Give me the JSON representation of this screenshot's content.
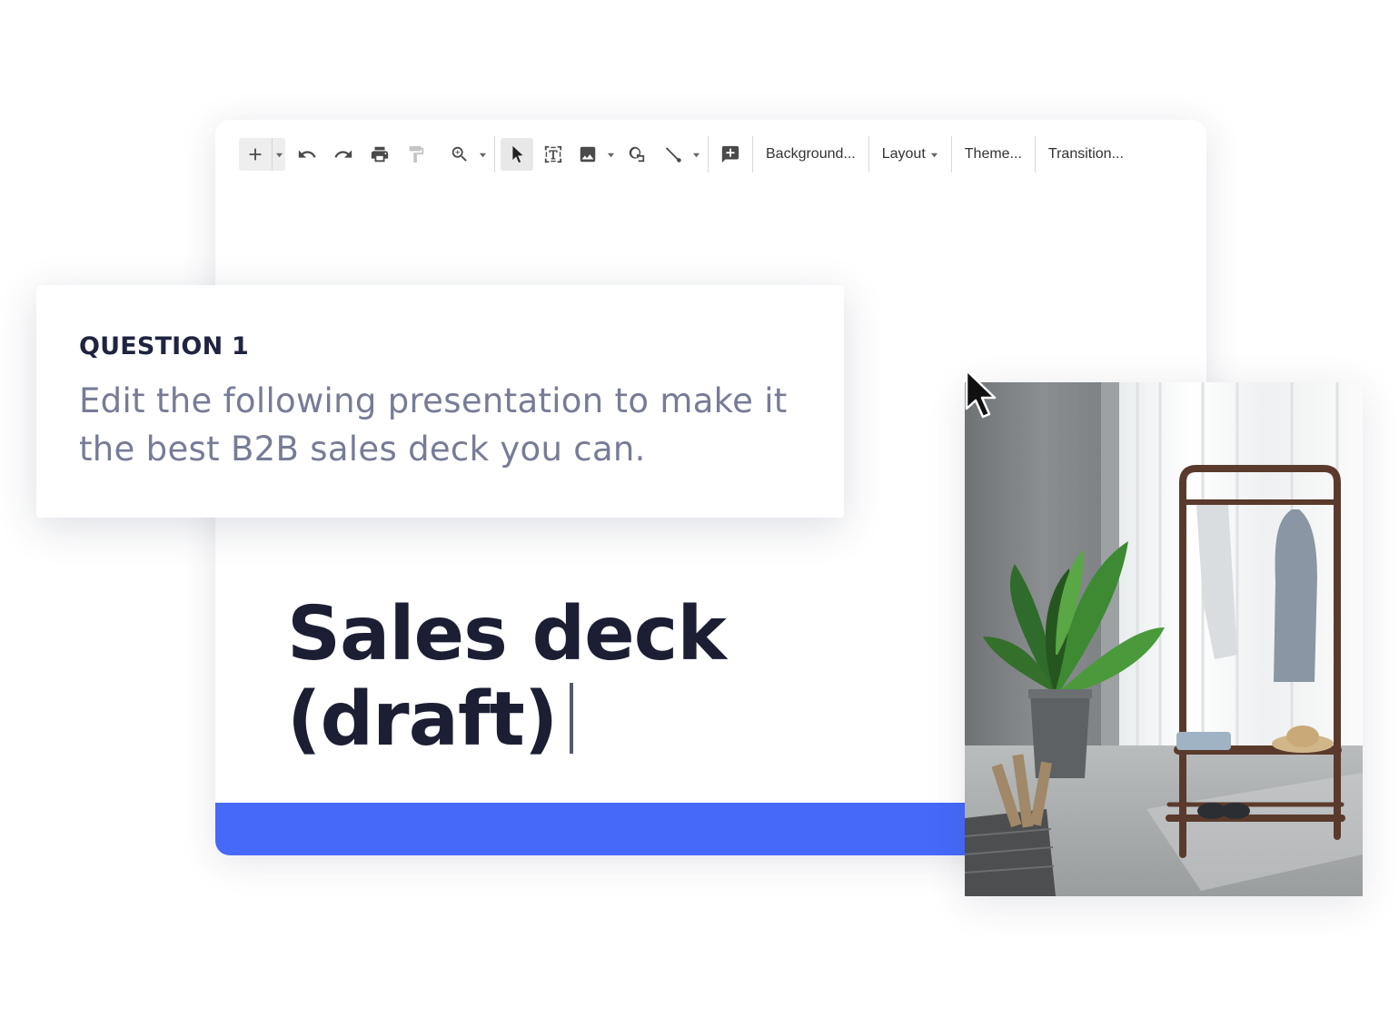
{
  "toolbar": {
    "background_label": "Background...",
    "layout_label": "Layout",
    "theme_label": "Theme...",
    "transition_label": "Transition..."
  },
  "question": {
    "label": "QUESTION 1",
    "text": "Edit the following presentation to make it the best B2B sales deck you can."
  },
  "slide": {
    "title_line1": "Sales deck",
    "title_line2": "(draft)"
  },
  "colors": {
    "accent_bar": "#4669fa",
    "title_text": "#1c1f33",
    "question_text": "#777c96"
  },
  "icons": [
    "plus-icon",
    "undo-icon",
    "redo-icon",
    "print-icon",
    "paint-format-icon",
    "zoom-icon",
    "select-cursor-icon",
    "text-box-icon",
    "image-icon",
    "shape-icon",
    "line-icon",
    "comment-add-icon",
    "mouse-pointer-icon"
  ]
}
